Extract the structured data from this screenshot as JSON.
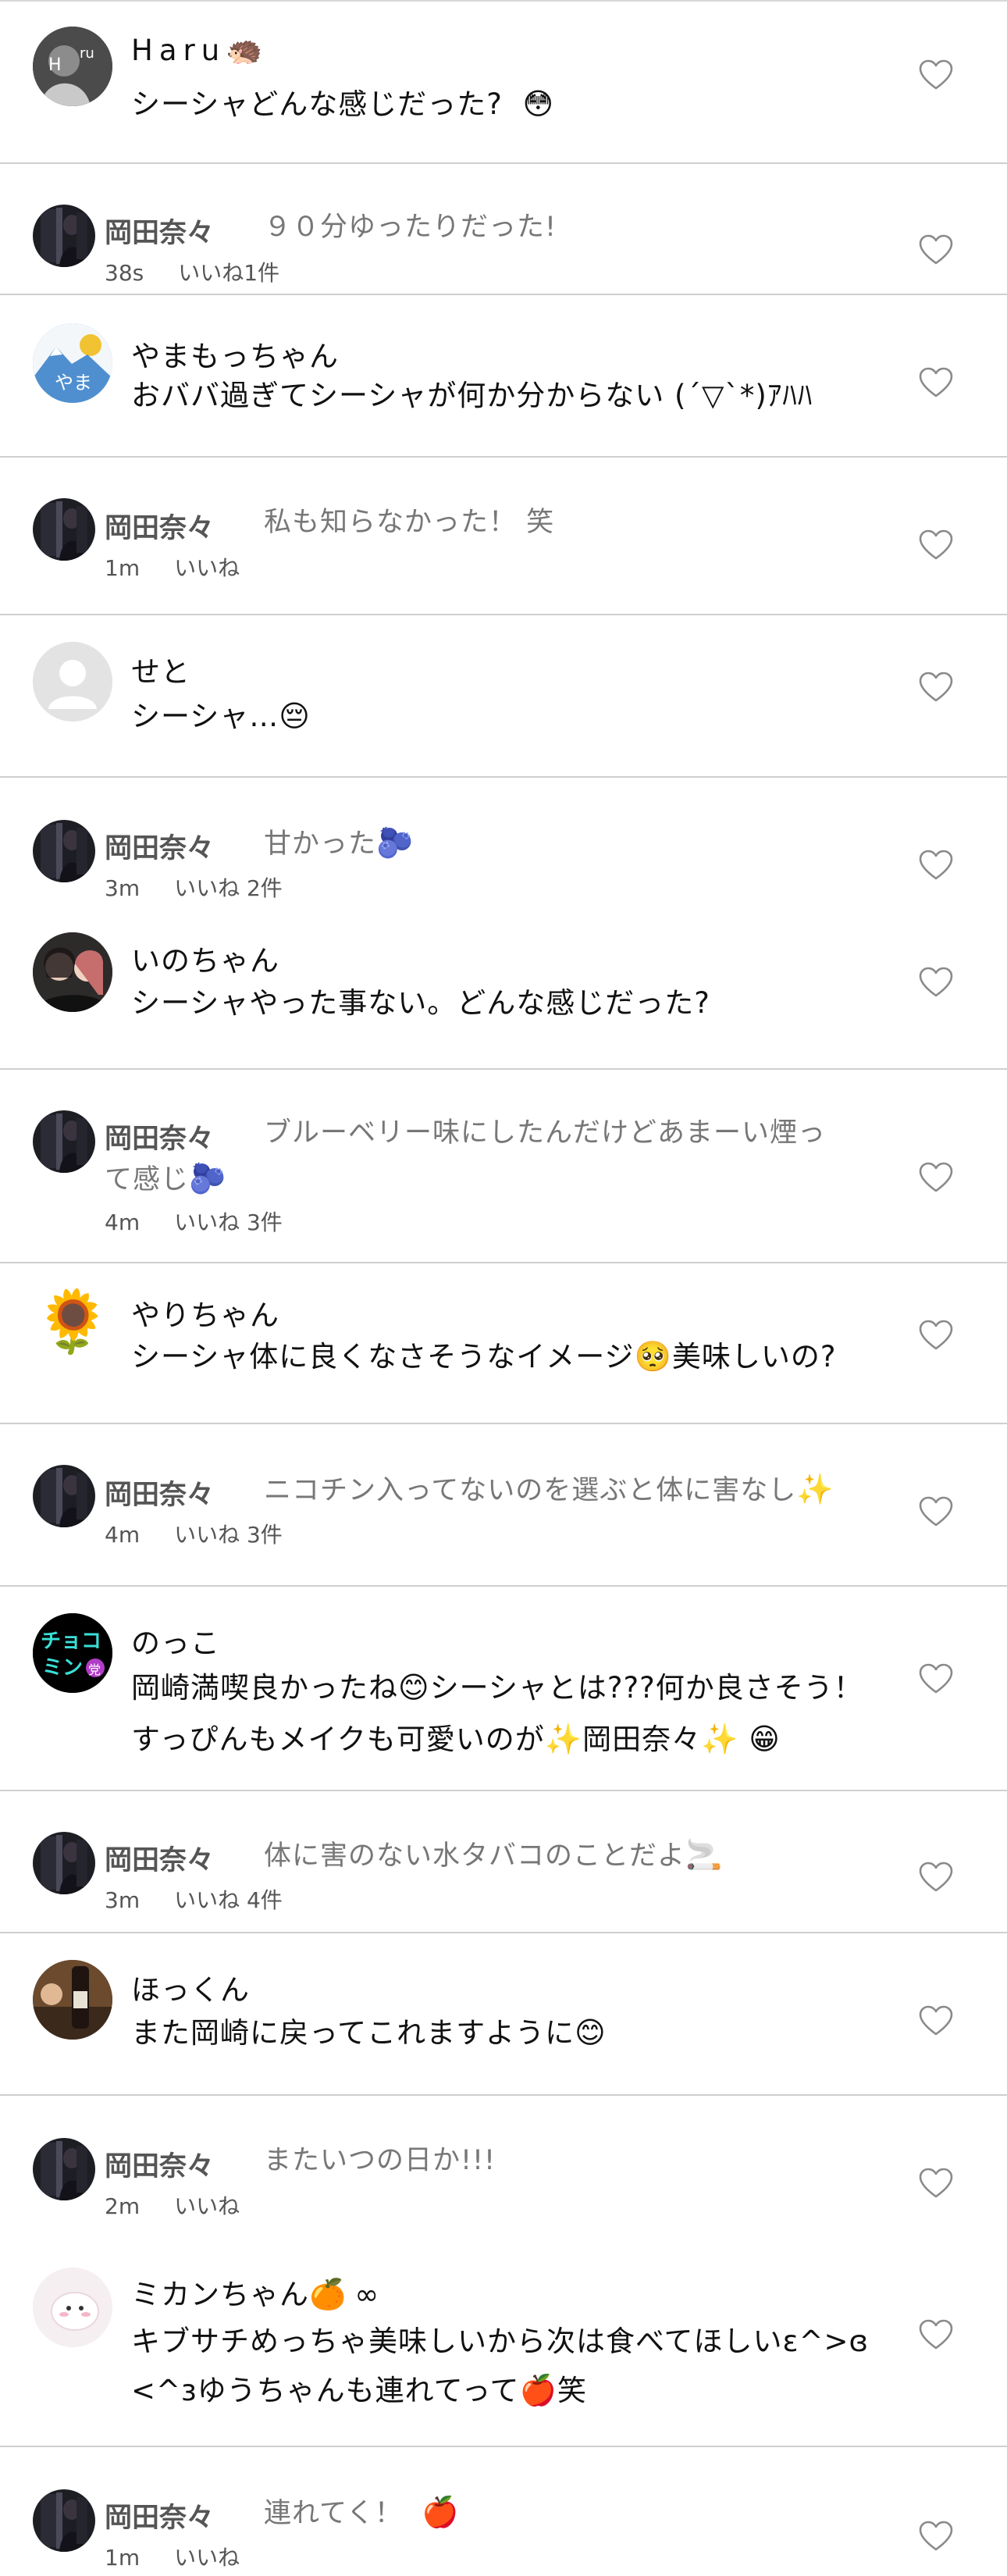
{
  "comments": [
    {
      "id": "c1",
      "name": "Haru",
      "name_emoji": "🦔",
      "text": "シーシャどんな感じだった?",
      "text_emoji": "😳"
    },
    {
      "id": "r1",
      "name": "岡田奈々",
      "text": "９０分ゆったりだった!",
      "time": "38s",
      "likes": "いいね1件"
    },
    {
      "id": "c2",
      "name": "やまもっちゃん",
      "text": "おババ過ぎてシーシャが何か分からない (´▽`*)ｱﾊﾊ",
      "avatar_text": "やま"
    },
    {
      "id": "r2",
      "name": "岡田奈々",
      "text": "私も知らなかった！ 笑",
      "time": "1m",
      "likes": "いいね"
    },
    {
      "id": "c3",
      "name": "せと",
      "text": "シーシャ…",
      "text_emoji": "😔"
    },
    {
      "id": "r3",
      "name": "岡田奈々",
      "text": "甘かった",
      "text_emoji": "🫐",
      "time": "3m",
      "likes": "いいね 2件"
    },
    {
      "id": "c4",
      "name": "いのちゃん",
      "text": "シーシャやった事ない。どんな感じだった?"
    },
    {
      "id": "r4",
      "name": "岡田奈々",
      "text_line1": "ブルーベリー味にしたんだけどあまーい煙っ",
      "text_line2": "て感じ",
      "text_emoji": "🫐",
      "time": "4m",
      "likes": "いいね 3件"
    },
    {
      "id": "c5",
      "name": "やりちゃん",
      "avatar_emoji": "🌻",
      "text_a": "シーシャ体に良くなさそうなイメージ",
      "text_emoji": "🥺",
      "text_b": "美味しいの?"
    },
    {
      "id": "r5",
      "name": "岡田奈々",
      "text": "ニコチン入ってないのを選ぶと体に害なし",
      "text_emoji": "✨",
      "time": "4m",
      "likes": "いいね 3件"
    },
    {
      "id": "c6",
      "name": "のっこ",
      "avatar_line1": "チョコ",
      "avatar_line2": "ミン",
      "avatar_badge": "党",
      "line1_a": "岡崎満喫良かったね",
      "line1_emoji": "😊",
      "line1_b": "シーシャとは???何か良さそう！",
      "line2_a": "すっぴんもメイクも可愛いのが",
      "line2_emoji1": "✨",
      "line2_b": "岡田奈々",
      "line2_emoji2": "✨",
      "line2_emoji3": "😁"
    },
    {
      "id": "r6",
      "name": "岡田奈々",
      "text": "体に害のない水タバコのことだよ",
      "text_emoji": "🚬",
      "time": "3m",
      "likes": "いいね 4件"
    },
    {
      "id": "c7",
      "name": "ほっくん",
      "text": "また岡崎に戻ってこれますように",
      "text_emoji": "😊"
    },
    {
      "id": "r7",
      "name": "岡田奈々",
      "text": "またいつの日か!!!",
      "time": "2m",
      "likes": "いいね"
    },
    {
      "id": "c8",
      "name": "ミカンちゃん",
      "name_emoji": "🍊",
      "name_suffix": "∞",
      "line1": "キブサチめっちゃ美味しいから次は食べてほしいɛ^>ɞ",
      "line2_a": "<^зゆうちゃんも連れてって",
      "line2_emoji": "🍎",
      "line2_b": "笑"
    },
    {
      "id": "r8",
      "name": "岡田奈々",
      "text": "連れてく！",
      "text_emoji": "🍎",
      "time": "1m",
      "likes": "いいね"
    }
  ],
  "icons": {
    "like": "heart-outline-icon"
  },
  "colors": {
    "separator": "#cfcfcf",
    "meta_text": "#555555",
    "reply_text": "#777777"
  }
}
